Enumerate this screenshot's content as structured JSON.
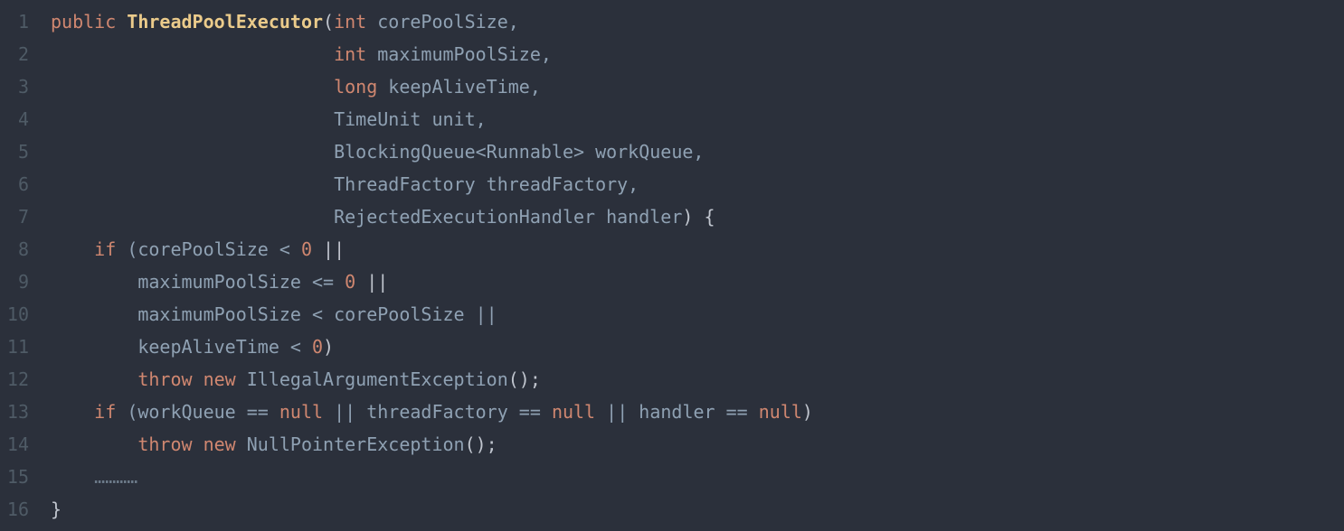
{
  "code": {
    "lines": [
      {
        "num": "1",
        "tokens": [
          {
            "t": "public",
            "cls": "keyword"
          },
          {
            "t": " ",
            "cls": ""
          },
          {
            "t": "ThreadPoolExecutor",
            "cls": "type-name"
          },
          {
            "t": "(",
            "cls": "punct"
          },
          {
            "t": "int",
            "cls": "primitive"
          },
          {
            "t": " ",
            "cls": ""
          },
          {
            "t": "corePoolSize,",
            "cls": "identifier"
          }
        ],
        "indent": ""
      },
      {
        "num": "2",
        "tokens": [
          {
            "t": "int",
            "cls": "primitive"
          },
          {
            "t": " ",
            "cls": ""
          },
          {
            "t": "maximumPoolSize,",
            "cls": "identifier"
          }
        ],
        "indent": "                          "
      },
      {
        "num": "3",
        "tokens": [
          {
            "t": "long",
            "cls": "primitive"
          },
          {
            "t": " ",
            "cls": ""
          },
          {
            "t": "keepAliveTime,",
            "cls": "identifier"
          }
        ],
        "indent": "                          "
      },
      {
        "num": "4",
        "tokens": [
          {
            "t": "TimeUnit unit,",
            "cls": "identifier"
          }
        ],
        "indent": "                          "
      },
      {
        "num": "5",
        "tokens": [
          {
            "t": "BlockingQueue<Runnable> workQueue,",
            "cls": "identifier"
          }
        ],
        "indent": "                          "
      },
      {
        "num": "6",
        "tokens": [
          {
            "t": "ThreadFactory threadFactory,",
            "cls": "identifier"
          }
        ],
        "indent": "                          "
      },
      {
        "num": "7",
        "tokens": [
          {
            "t": "RejectedExecutionHandler handler",
            "cls": "identifier"
          },
          {
            "t": ")",
            "cls": "punct"
          },
          {
            "t": " ",
            "cls": ""
          },
          {
            "t": "{",
            "cls": "punct"
          }
        ],
        "indent": "                          "
      },
      {
        "num": "8",
        "tokens": [
          {
            "t": "if",
            "cls": "keyword"
          },
          {
            "t": " ",
            "cls": ""
          },
          {
            "t": "(corePoolSize < ",
            "cls": "identifier"
          },
          {
            "t": "0",
            "cls": "number"
          },
          {
            "t": " ||",
            "cls": "operator"
          }
        ],
        "indent": "    "
      },
      {
        "num": "9",
        "tokens": [
          {
            "t": "maximumPoolSize <= ",
            "cls": "identifier"
          },
          {
            "t": "0",
            "cls": "number"
          },
          {
            "t": " ||",
            "cls": "operator"
          }
        ],
        "indent": "        "
      },
      {
        "num": "10",
        "tokens": [
          {
            "t": "maximumPoolSize < corePoolSize ||",
            "cls": "identifier"
          }
        ],
        "indent": "        "
      },
      {
        "num": "11",
        "tokens": [
          {
            "t": "keepAliveTime < ",
            "cls": "identifier"
          },
          {
            "t": "0",
            "cls": "number"
          },
          {
            "t": ")",
            "cls": "punct"
          }
        ],
        "indent": "        "
      },
      {
        "num": "12",
        "tokens": [
          {
            "t": "throw",
            "cls": "keyword"
          },
          {
            "t": " ",
            "cls": ""
          },
          {
            "t": "new",
            "cls": "keyword"
          },
          {
            "t": " ",
            "cls": ""
          },
          {
            "t": "IllegalArgumentException",
            "cls": "identifier"
          },
          {
            "t": "();",
            "cls": "punct"
          }
        ],
        "indent": "        "
      },
      {
        "num": "13",
        "tokens": [
          {
            "t": "if",
            "cls": "keyword"
          },
          {
            "t": " ",
            "cls": ""
          },
          {
            "t": "(workQueue == ",
            "cls": "identifier"
          },
          {
            "t": "null",
            "cls": "keyword"
          },
          {
            "t": " || threadFactory == ",
            "cls": "identifier"
          },
          {
            "t": "null",
            "cls": "keyword"
          },
          {
            "t": " || handler == ",
            "cls": "identifier"
          },
          {
            "t": "null",
            "cls": "keyword"
          },
          {
            "t": ")",
            "cls": "punct"
          }
        ],
        "indent": "    "
      },
      {
        "num": "14",
        "tokens": [
          {
            "t": "throw",
            "cls": "keyword"
          },
          {
            "t": " ",
            "cls": ""
          },
          {
            "t": "new",
            "cls": "keyword"
          },
          {
            "t": " ",
            "cls": ""
          },
          {
            "t": "NullPointerException",
            "cls": "identifier"
          },
          {
            "t": "();",
            "cls": "punct"
          }
        ],
        "indent": "        "
      },
      {
        "num": "15",
        "tokens": [
          {
            "t": "…………",
            "cls": "dimmed"
          }
        ],
        "indent": "    "
      },
      {
        "num": "16",
        "tokens": [
          {
            "t": "}",
            "cls": "punct"
          }
        ],
        "indent": ""
      }
    ]
  }
}
